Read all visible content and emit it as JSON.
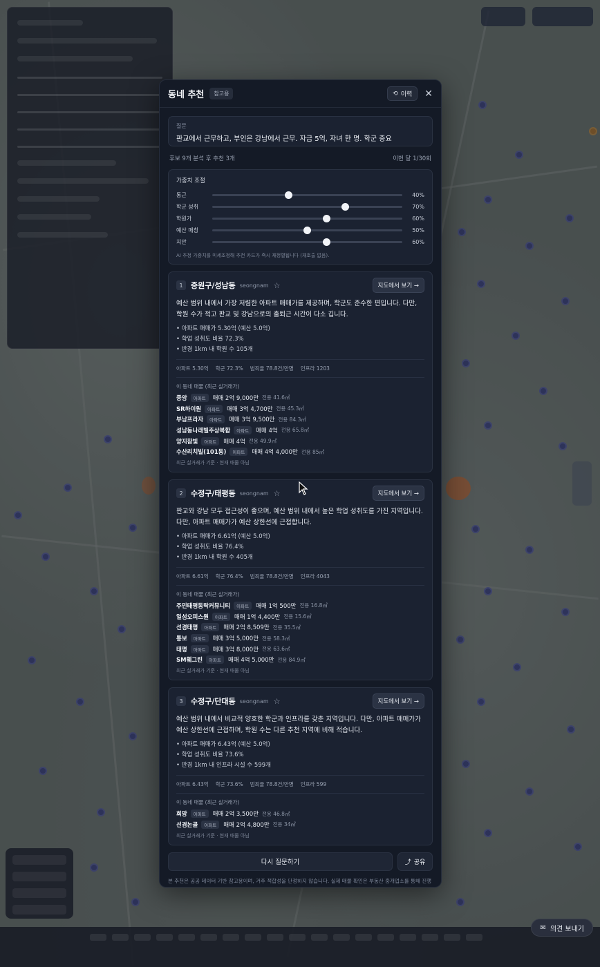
{
  "modal": {
    "title": "동네 추천",
    "badge": "참고용",
    "history_label": "이력",
    "close_label": "✕",
    "question_label": "질문",
    "question_text": "판교에서 근무하고, 부인은 강남에서 근무. 자금 5억, 자녀 한 명. 학군 중요",
    "analysis_meta": "후보 9개 분석 후 추천 3개",
    "usage_meta": "이번 달 1/30회"
  },
  "weights": {
    "title": "가중치 조절",
    "items": [
      {
        "label": "통근",
        "value": 40,
        "display": "40%"
      },
      {
        "label": "학군 성취",
        "value": 70,
        "display": "70%"
      },
      {
        "label": "학원가",
        "value": 60,
        "display": "60%"
      },
      {
        "label": "예산 매칭",
        "value": 50,
        "display": "50%"
      },
      {
        "label": "치안",
        "value": 60,
        "display": "60%"
      }
    ],
    "note": "AI 추정 가중치를 미세조정해 추천 카드가 즉시 재정렬됩니다 (재호출 없음)."
  },
  "cards": [
    {
      "rank": "1",
      "name": "중원구/성남동",
      "region": "seongnam",
      "map_button": "지도에서 보기 →",
      "description": "예산 범위 내에서 가장 저렴한 아파트 매매가를 제공하며, 학군도 준수한 편입니다. 다만, 학원 수가 적고 판교 및 강남으로의 출퇴근 시간이 다소 깁니다.",
      "bullets": [
        "• 아파트 매매가 5.30억 (예산 5.0억)",
        "• 학업 성취도 비율 72.3%",
        "• 반경 1km 내 학원 수 105개"
      ],
      "stats": [
        "아파트 5.30억",
        "학군 72.3%",
        "범죄율 78.8건/만명",
        "인프라 1203"
      ],
      "listing_title": "이 동네 매물 (최근 실거래가)",
      "listings": [
        {
          "name": "중앙",
          "type": "아파트",
          "price": "매매 2억 9,000만",
          "size": "전용 41.6㎡"
        },
        {
          "name": "SR하이원",
          "type": "아파트",
          "price": "매매 3억 4,700만",
          "size": "전용 45.3㎡"
        },
        {
          "name": "부남프라자",
          "type": "아파트",
          "price": "매매 3억 9,500만",
          "size": "전용 84.3㎡"
        },
        {
          "name": "성남동나래빌주상복합",
          "type": "아파트",
          "price": "매매 4억",
          "size": "전용 65.8㎡"
        },
        {
          "name": "양지참빛",
          "type": "아파트",
          "price": "매매 4억",
          "size": "전용 49.9㎡"
        },
        {
          "name": "수산리치빌(101동)",
          "type": "아파트",
          "price": "매매 4억 4,000만",
          "size": "전용 85㎡"
        }
      ],
      "listing_note": "최근 실거래가 기준 · 현재 매물 아님"
    },
    {
      "rank": "2",
      "name": "수정구/태평동",
      "region": "seongnam",
      "map_button": "지도에서 보기 →",
      "description": "판교와 강남 모두 접근성이 좋으며, 예산 범위 내에서 높은 학업 성취도를 가진 지역입니다. 다만, 아파트 매매가가 예산 상한선에 근접합니다.",
      "bullets": [
        "• 아파트 매매가 6.61억 (예산 5.0억)",
        "• 학업 성취도 비율 76.4%",
        "• 반경 1km 내 학원 수 405개"
      ],
      "stats": [
        "아파트 6.61억",
        "학군 76.4%",
        "범죄율 78.8건/만명",
        "인프라 4043"
      ],
      "listing_title": "이 동네 매물 (최근 실거래가)",
      "listings": [
        {
          "name": "주민태평동락커뮤니티",
          "type": "아파트",
          "price": "매매 1억 500만",
          "size": "전용 16.8㎡"
        },
        {
          "name": "일성오피스원",
          "type": "아파트",
          "price": "매매 1억 4,400만",
          "size": "전용 15.6㎡"
        },
        {
          "name": "선경태평",
          "type": "아파트",
          "price": "매매 2억 8,509만",
          "size": "전용 35.5㎡"
        },
        {
          "name": "통보",
          "type": "아파트",
          "price": "매매 3억 5,000만",
          "size": "전용 58.3㎡"
        },
        {
          "name": "태평",
          "type": "아파트",
          "price": "매매 3억 8,000만",
          "size": "전용 63.6㎡"
        },
        {
          "name": "SM훼그린",
          "type": "아파트",
          "price": "매매 4억 5,000만",
          "size": "전용 84.9㎡"
        }
      ],
      "listing_note": "최근 실거래가 기준 · 현재 매물 아님"
    },
    {
      "rank": "3",
      "name": "수정구/단대동",
      "region": "seongnam",
      "map_button": "지도에서 보기 →",
      "description": "예산 범위 내에서 비교적 양호한 학군과 인프라를 갖춘 지역입니다. 다만, 아파트 매매가가 예산 상한선에 근접하며, 학원 수는 다른 추천 지역에 비해 적습니다.",
      "bullets": [
        "• 아파트 매매가 6.43억 (예산 5.0억)",
        "• 학업 성취도 비율 73.6%",
        "• 반경 1km 내 인프라 시설 수 599개"
      ],
      "stats": [
        "아파트 6.43억",
        "학군 73.6%",
        "범죄율 78.8건/만명",
        "인프라 599"
      ],
      "listing_title": "이 동네 매물 (최근 실거래가)",
      "listings": [
        {
          "name": "희망",
          "type": "아파트",
          "price": "매매 2억 3,500만",
          "size": "전용 46.8㎡"
        },
        {
          "name": "선경논골",
          "type": "아파트",
          "price": "매매 2억 4,800만",
          "size": "전용 34㎡"
        }
      ],
      "listing_note": "최근 실거래가 기준 · 현재 매물 아님"
    }
  ],
  "actions": {
    "ask_again": "다시 질문하기",
    "share": "공유"
  },
  "disclaimer": "본 추천은 공공 데이터 기반 참고용이며, 거주 적합성을 단정하지 않습니다. 실제 매물 확인은 부동산 중개업소를 통해 진행하세요.",
  "feedback_label": "의견 보내기",
  "icons": {
    "history": "history-icon",
    "close": "close-icon",
    "star": "star-icon",
    "share": "share-icon",
    "feedback": "mail-icon"
  }
}
